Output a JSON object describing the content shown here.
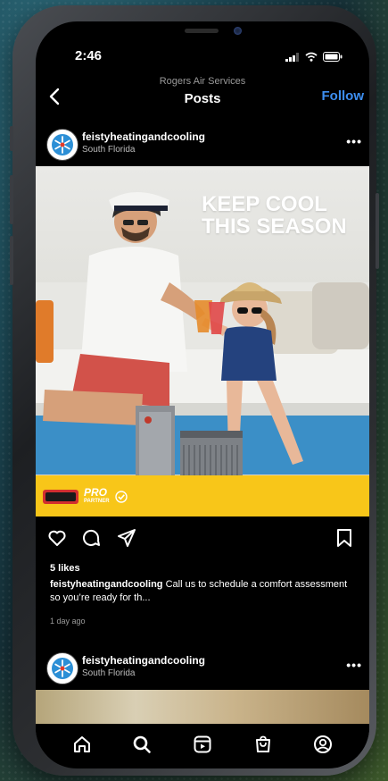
{
  "status_bar": {
    "time": "2:46"
  },
  "header": {
    "account": "Rogers Air Services",
    "title": "Posts",
    "follow_label": "Follow"
  },
  "post": {
    "username": "feistyheatingandcooling",
    "location": "South Florida",
    "image": {
      "headline_line1": "KEEP COOL",
      "headline_line2": "THIS SEASON",
      "badge_text": "PRO",
      "badge_sub": "PARTNER",
      "brand_color": "#f8c619"
    },
    "likes": "5 likes",
    "caption_user": "feistyheatingandcooling",
    "caption_text": " Call us to schedule a comfort assessment so you’re ready for th...",
    "time_ago": "1 day ago"
  },
  "next_post": {
    "username": "feistyheatingandcooling",
    "location": "South Florida"
  },
  "colors": {
    "accent": "#3d8ef0",
    "background": "#000000"
  },
  "icons": {
    "actions": [
      "heart-icon",
      "comment-icon",
      "share-icon",
      "bookmark-icon"
    ],
    "nav": [
      "home-icon",
      "search-icon",
      "reels-icon",
      "shop-icon",
      "profile-icon"
    ]
  }
}
